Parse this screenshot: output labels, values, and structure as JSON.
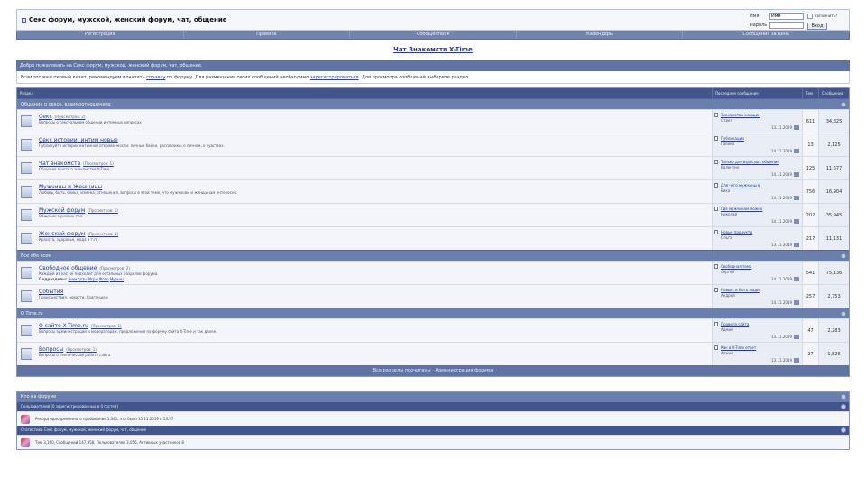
{
  "header": {
    "site_title": "Секс форум, мужской, женский форум, чат, общение",
    "login": {
      "user_label": "Имя",
      "user_value": "Имя",
      "pass_label": "Пароль",
      "remember_label": "Запомнить?",
      "submit_label": "Вход"
    }
  },
  "nav": [
    "Регистрация",
    "Правила",
    "Сообщество ▾",
    "Календарь",
    "Сообщения за день"
  ],
  "page_title": "Чат Знакомств X-Time",
  "welcome": {
    "bar": "Добро пожаловать на Секс форум, мужской, женский форум, чат, общение.",
    "text_pre": "Если это ваш первый визит, рекомендуем почитать ",
    "link1": "справку",
    "text_mid": " по форуму. Для размещения своих сообщений необходимо ",
    "link2": "зарегистрироваться",
    "text_post": ". Для просмотра сообщений выберите раздел."
  },
  "table_header": {
    "forum": "Раздел",
    "last_post": "Последнее сообщение",
    "topics": "Тем",
    "posts": "Сообщений"
  },
  "categories": [
    {
      "name": "Общение о сексе, взаимоотношениях",
      "forums": [
        {
          "name": "Секс",
          "mod": "(Просмотров: 2)",
          "desc": "Вопросы о сексуальном общении интимных вопросах",
          "sub": "",
          "sub_items": [],
          "last_title": "Знакомства женщин",
          "last_by": "Ответ",
          "last_date": "13.11.2019",
          "topics": "611",
          "posts": "34,825"
        },
        {
          "name": "Секс истории, интим новые",
          "mod": "",
          "desc": "Публикуйте истории интимной откровенности: личные байки, рассказики, о личном, о чувствах.",
          "sub": "",
          "sub_items": [],
          "last_title": "Публикации",
          "last_by": "Галина",
          "last_date": "14.11.2019",
          "topics": "13",
          "posts": "2,125"
        },
        {
          "name": "Чат знакомств",
          "mod": "(Просмотров: 1)",
          "desc": "Общение в чате о знакомстве X-Time",
          "sub": "",
          "sub_items": [],
          "last_title": "Только для взрослых общение",
          "last_by": "Валентин",
          "last_date": "14.11.2019",
          "topics": "125",
          "posts": "11,677"
        },
        {
          "name": "Мужчины и Женщины",
          "mod": "",
          "desc": "Любовь, быть, семья, измена, отношения, вопросы в этой теме, что мужчинам и женщинам интересно.",
          "sub": "",
          "sub_items": [],
          "last_title": "Для чего мужчины в",
          "last_by": "Вика",
          "last_date": "14.11.2019",
          "topics": "756",
          "posts": "16,904"
        },
        {
          "name": "Мужской форум",
          "mod": "(Просмотров: 1)",
          "desc": "Общение мужских тем",
          "sub": "",
          "sub_items": [],
          "last_title": "Где мужчинам можно",
          "last_by": "Николай",
          "last_date": "14.11.2019",
          "topics": "202",
          "posts": "35,945"
        },
        {
          "name": "Женский форум",
          "mod": "(Просмотров: 1)",
          "desc": "Красота, здоровье, мода и т.п.",
          "sub": "",
          "sub_items": [],
          "last_title": "Новые продукты",
          "last_by": "Ольга",
          "last_date": "13.11.2019",
          "topics": "217",
          "posts": "11,131"
        }
      ]
    },
    {
      "name": "Все обо всем",
      "forums": [
        {
          "name": "Свободное общение",
          "mod": "(Просмотров: 2)",
          "desc": "Каждый из нас не подходит для остальных разделов форума.",
          "sub": "Подразделы:",
          "sub_items": [
            "Анекдоты",
            "Игры",
            "Фото",
            "Музыка"
          ],
          "last_title": "Свободная тема",
          "last_by": "Сергей",
          "last_date": "14.11.2019",
          "topics": "541",
          "posts": "75,136"
        },
        {
          "name": "События",
          "mod": "",
          "desc": "Происшествия, новости, Ураганшем",
          "sub": "",
          "sub_items": [],
          "last_title": "Новые, и быть люди",
          "last_by": "Андрей",
          "last_date": "14.11.2019",
          "topics": "257",
          "posts": "2,753"
        }
      ]
    },
    {
      "name": "О Time.ru",
      "forums": [
        {
          "name": "О сайте X-Time.ru",
          "mod": "(Просмотров: 1)",
          "desc": "Вопросы администрации и модераторам, предложения по форуму сайта X-Time и так далее.",
          "sub": "",
          "sub_items": [],
          "last_title": "Правила сайта",
          "last_by": "Админ",
          "last_date": "13.11.2019",
          "topics": "47",
          "posts": "2,283"
        },
        {
          "name": "Вопросы",
          "mod": "(Просмотров: 1)",
          "desc": "Вопросы о технической работе сайта",
          "sub": "",
          "sub_items": [],
          "last_title": "Как в X-Time ответ",
          "last_by": "Админ",
          "last_date": "13.11.2019",
          "topics": "27",
          "posts": "1,526"
        }
      ]
    }
  ],
  "footer_links": "Все разделы прочитаны · Администрация форума",
  "online": {
    "head": "Кто на форуме",
    "sub1": "Пользователей (0 зарегистрированных и 0 гостей)",
    "text1": "Рекорд одновременного пребывания 1,341, это было 15.11.2019 в 13:57",
    "sub2": "Статистика Секс форум, мужской, женский форум, чат, общение",
    "text2": "Тем 3,160, Сообщений 147,358, Пользователей 3,056, Активных участников 8"
  }
}
